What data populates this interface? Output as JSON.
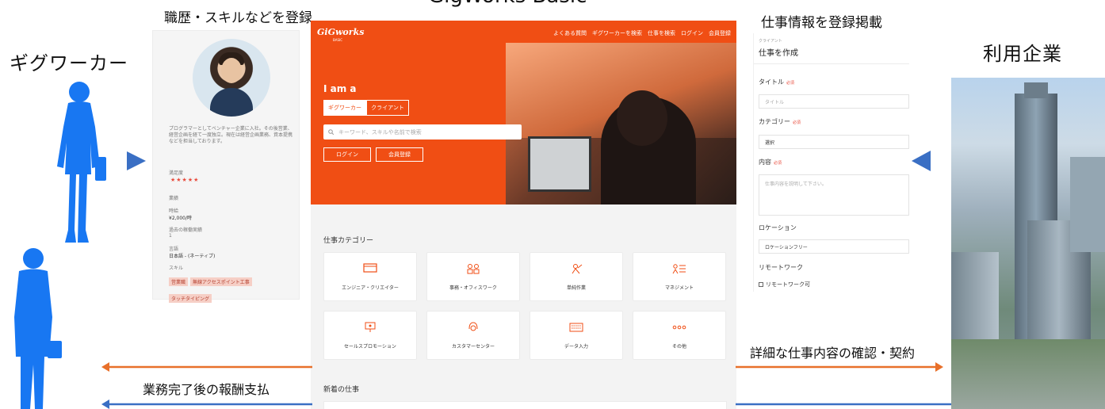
{
  "diagram": {
    "title": "GigWorks Basic",
    "left_label": "ギグワーカー",
    "right_label": "利用企業",
    "profile_caption": "職歴・スキルなどを登録",
    "form_caption": "仕事情報を登録掲載",
    "flow_right_text": "詳細な仕事内容の確認・契約",
    "flow_left_text": "業務完了後の報酬支払",
    "colors": {
      "silhouette": "#1877f2",
      "arrow_orange": "#e8702a",
      "arrow_blue": "#3a6fc4",
      "brand": "#f04e14"
    }
  },
  "profile": {
    "bio": "プログラマーとしてベンチャー企業に入社。その後営業、経営企画を経て一度独立。現在は経営企画業務、資本提携などを担当しております。",
    "rating_label": "満足度",
    "rating_stars": "★★★★★",
    "rank_label": "業績",
    "rate_label": "時給",
    "rate_value": "¥2,000/時",
    "recent_label": "過去の稼働実績",
    "recent_value": "1",
    "lang_label": "言語",
    "lang_value": "日本語 - (ネーティブ)",
    "skills_label": "スキル",
    "skills": [
      "営業職",
      "無線アクセスポイント工事",
      "タッチタイピング"
    ]
  },
  "site": {
    "logo": "GiGworks",
    "logo_sub": "BASIC",
    "nav": [
      "よくある質問",
      "ギグワーカーを検索",
      "仕事を検索",
      "ログイン",
      "会員登録"
    ],
    "hero_heading": "I am a",
    "segments": [
      "ギグワーカー",
      "クライアント"
    ],
    "search_placeholder": "キーワード、スキルや名前で検索",
    "login_button": "ログイン",
    "register_button": "会員登録",
    "category_title": "仕事カテゴリー",
    "categories": [
      {
        "label": "エンジニア・クリエイター",
        "icon": "monitor-icon"
      },
      {
        "label": "事務・オフィスワーク",
        "icon": "people-icon"
      },
      {
        "label": "単純作業",
        "icon": "worker-icon"
      },
      {
        "label": "マネジメント",
        "icon": "chart-person-icon"
      },
      {
        "label": "セールスプロモーション",
        "icon": "presentation-icon"
      },
      {
        "label": "カスタマーセンター",
        "icon": "headset-icon"
      },
      {
        "label": "データ入力",
        "icon": "keyboard-icon"
      },
      {
        "label": "その他",
        "icon": "dots-icon"
      }
    ],
    "new_jobs_title": "新着の仕事"
  },
  "form": {
    "breadcrumb": "クライアント",
    "heading": "仕事を作成",
    "required_mark": "必須",
    "title_label": "タイトル",
    "title_placeholder": "タイトル",
    "category_label": "カテゴリー",
    "category_value": "選択",
    "content_label": "内容",
    "content_placeholder": "仕事内容を説明して下さい。",
    "location_label": "ロケーション",
    "location_value": "ロケーションフリー",
    "remote_label": "リモートワーク",
    "remote_checkbox_label": "リモートワーク可"
  }
}
